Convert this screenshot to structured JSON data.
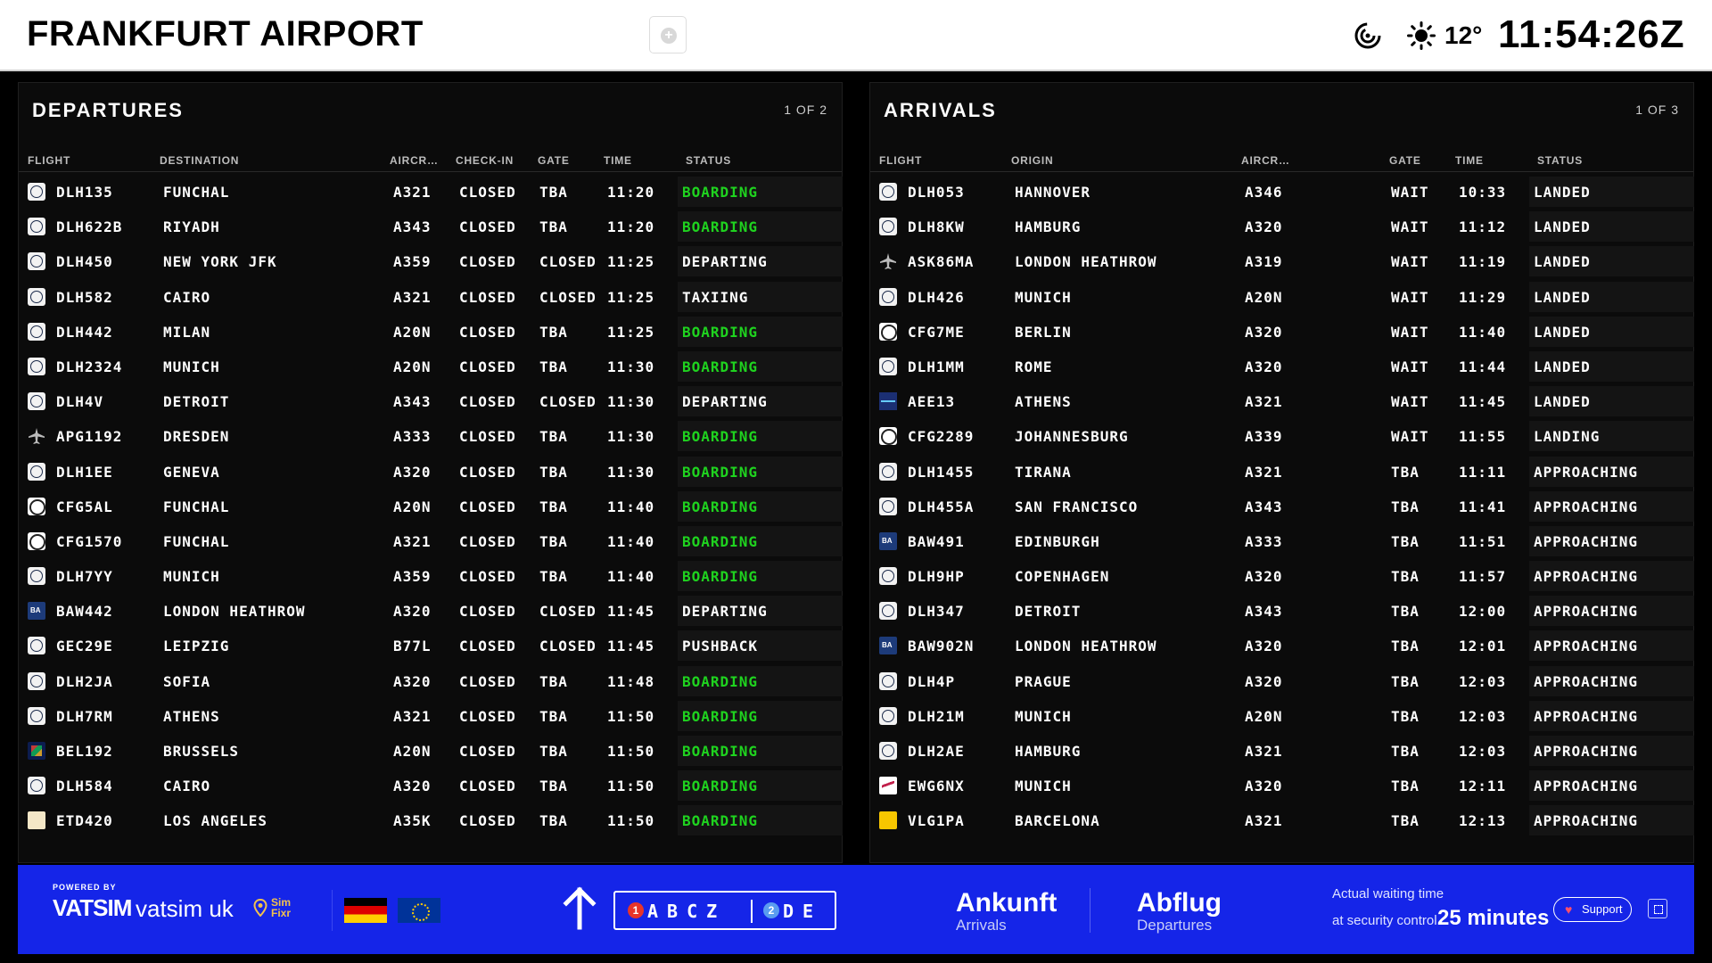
{
  "header": {
    "title": "FRANKFURT AIRPORT",
    "temperature": "12°",
    "clock": "11:54:26Z",
    "icons": {
      "add": "plus-circle-icon",
      "radar": "radar-icon",
      "weather": "sun-icon"
    }
  },
  "departures": {
    "title": "DEPARTURES",
    "page": "1 OF 2",
    "columns": {
      "flight": "FLIGHT",
      "destination": "DESTINATION",
      "aircraft": "AIRCR…",
      "checkin": "CHECK-IN",
      "gate": "GATE",
      "time": "TIME",
      "status": "STATUS"
    },
    "rows": [
      {
        "logo": "lh",
        "flight": "DLH135",
        "place": "FUNCHAL",
        "aircraft": "A321",
        "checkin": "CLOSED",
        "gate": "TBA",
        "time": "11:20",
        "status": "BOARDING",
        "highlight": true
      },
      {
        "logo": "lh",
        "flight": "DLH622B",
        "place": "RIYADH",
        "aircraft": "A343",
        "checkin": "CLOSED",
        "gate": "TBA",
        "time": "11:20",
        "status": "BOARDING",
        "highlight": true
      },
      {
        "logo": "lh",
        "flight": "DLH450",
        "place": "NEW YORK JFK",
        "aircraft": "A359",
        "checkin": "CLOSED",
        "gate": "CLOSED",
        "time": "11:25",
        "status": "DEPARTING",
        "highlight": false
      },
      {
        "logo": "lh",
        "flight": "DLH582",
        "place": "CAIRO",
        "aircraft": "A321",
        "checkin": "CLOSED",
        "gate": "CLOSED",
        "time": "11:25",
        "status": "TAXIING",
        "highlight": false
      },
      {
        "logo": "lh",
        "flight": "DLH442",
        "place": "MILAN",
        "aircraft": "A20N",
        "checkin": "CLOSED",
        "gate": "TBA",
        "time": "11:25",
        "status": "BOARDING",
        "highlight": true
      },
      {
        "logo": "lh",
        "flight": "DLH2324",
        "place": "MUNICH",
        "aircraft": "A20N",
        "checkin": "CLOSED",
        "gate": "TBA",
        "time": "11:30",
        "status": "BOARDING",
        "highlight": true
      },
      {
        "logo": "lh",
        "flight": "DLH4V",
        "place": "DETROIT",
        "aircraft": "A343",
        "checkin": "CLOSED",
        "gate": "CLOSED",
        "time": "11:30",
        "status": "DEPARTING",
        "highlight": false
      },
      {
        "logo": "plane",
        "flight": "APG1192",
        "place": "DRESDEN",
        "aircraft": "A333",
        "checkin": "CLOSED",
        "gate": "TBA",
        "time": "11:30",
        "status": "BOARDING",
        "highlight": true
      },
      {
        "logo": "lh",
        "flight": "DLH1EE",
        "place": "GENEVA",
        "aircraft": "A320",
        "checkin": "CLOSED",
        "gate": "TBA",
        "time": "11:30",
        "status": "BOARDING",
        "highlight": true
      },
      {
        "logo": "cf",
        "flight": "CFG5AL",
        "place": "FUNCHAL",
        "aircraft": "A20N",
        "checkin": "CLOSED",
        "gate": "TBA",
        "time": "11:40",
        "status": "BOARDING",
        "highlight": true
      },
      {
        "logo": "cf",
        "flight": "CFG1570",
        "place": "FUNCHAL",
        "aircraft": "A321",
        "checkin": "CLOSED",
        "gate": "TBA",
        "time": "11:40",
        "status": "BOARDING",
        "highlight": true
      },
      {
        "logo": "lh",
        "flight": "DLH7YY",
        "place": "MUNICH",
        "aircraft": "A359",
        "checkin": "CLOSED",
        "gate": "TBA",
        "time": "11:40",
        "status": "BOARDING",
        "highlight": true
      },
      {
        "logo": "ba",
        "flight": "BAW442",
        "place": "LONDON HEATHROW",
        "aircraft": "A320",
        "checkin": "CLOSED",
        "gate": "CLOSED",
        "time": "11:45",
        "status": "DEPARTING",
        "highlight": false
      },
      {
        "logo": "lh",
        "flight": "GEC29E",
        "place": "LEIPZIG",
        "aircraft": "B77L",
        "checkin": "CLOSED",
        "gate": "CLOSED",
        "time": "11:45",
        "status": "PUSHBACK",
        "highlight": false
      },
      {
        "logo": "lh",
        "flight": "DLH2JA",
        "place": "SOFIA",
        "aircraft": "A320",
        "checkin": "CLOSED",
        "gate": "TBA",
        "time": "11:48",
        "status": "BOARDING",
        "highlight": true
      },
      {
        "logo": "lh",
        "flight": "DLH7RM",
        "place": "ATHENS",
        "aircraft": "A321",
        "checkin": "CLOSED",
        "gate": "TBA",
        "time": "11:50",
        "status": "BOARDING",
        "highlight": true
      },
      {
        "logo": "bel",
        "flight": "BEL192",
        "place": "BRUSSELS",
        "aircraft": "A20N",
        "checkin": "CLOSED",
        "gate": "TBA",
        "time": "11:50",
        "status": "BOARDING",
        "highlight": true
      },
      {
        "logo": "lh",
        "flight": "DLH584",
        "place": "CAIRO",
        "aircraft": "A320",
        "checkin": "CLOSED",
        "gate": "TBA",
        "time": "11:50",
        "status": "BOARDING",
        "highlight": true
      },
      {
        "logo": "etd",
        "flight": "ETD420",
        "place": "LOS ANGELES",
        "aircraft": "A35K",
        "checkin": "CLOSED",
        "gate": "TBA",
        "time": "11:50",
        "status": "BOARDING",
        "highlight": true
      }
    ]
  },
  "arrivals": {
    "title": "ARRIVALS",
    "page": "1 OF 3",
    "columns": {
      "flight": "FLIGHT",
      "origin": "ORIGIN",
      "aircraft": "AIRCR…",
      "gate": "GATE",
      "time": "TIME",
      "status": "STATUS"
    },
    "rows": [
      {
        "logo": "lh",
        "flight": "DLH053",
        "place": "HANNOVER",
        "aircraft": "A346",
        "gate": "WAIT",
        "time": "10:33",
        "status": "LANDED"
      },
      {
        "logo": "lh",
        "flight": "DLH8KW",
        "place": "HAMBURG",
        "aircraft": "A320",
        "gate": "WAIT",
        "time": "11:12",
        "status": "LANDED"
      },
      {
        "logo": "plane",
        "flight": "ASK86MA",
        "place": "LONDON HEATHROW",
        "aircraft": "A319",
        "gate": "WAIT",
        "time": "11:19",
        "status": "LANDED"
      },
      {
        "logo": "lh",
        "flight": "DLH426",
        "place": "MUNICH",
        "aircraft": "A20N",
        "gate": "WAIT",
        "time": "11:29",
        "status": "LANDED"
      },
      {
        "logo": "cf",
        "flight": "CFG7ME",
        "place": "BERLIN",
        "aircraft": "A320",
        "gate": "WAIT",
        "time": "11:40",
        "status": "LANDED"
      },
      {
        "logo": "lh",
        "flight": "DLH1MM",
        "place": "ROME",
        "aircraft": "A320",
        "gate": "WAIT",
        "time": "11:44",
        "status": "LANDED"
      },
      {
        "logo": "aee",
        "flight": "AEE13",
        "place": "ATHENS",
        "aircraft": "A321",
        "gate": "WAIT",
        "time": "11:45",
        "status": "LANDED"
      },
      {
        "logo": "cf",
        "flight": "CFG2289",
        "place": "JOHANNESBURG",
        "aircraft": "A339",
        "gate": "WAIT",
        "time": "11:55",
        "status": "LANDING"
      },
      {
        "logo": "lh",
        "flight": "DLH1455",
        "place": "TIRANA",
        "aircraft": "A321",
        "gate": "TBA",
        "time": "11:11",
        "status": "APPROACHING"
      },
      {
        "logo": "lh",
        "flight": "DLH455A",
        "place": "SAN FRANCISCO",
        "aircraft": "A343",
        "gate": "TBA",
        "time": "11:41",
        "status": "APPROACHING"
      },
      {
        "logo": "ba",
        "flight": "BAW491",
        "place": "EDINBURGH",
        "aircraft": "A333",
        "gate": "TBA",
        "time": "11:51",
        "status": "APPROACHING"
      },
      {
        "logo": "lh",
        "flight": "DLH9HP",
        "place": "COPENHAGEN",
        "aircraft": "A320",
        "gate": "TBA",
        "time": "11:57",
        "status": "APPROACHING"
      },
      {
        "logo": "lh",
        "flight": "DLH347",
        "place": "DETROIT",
        "aircraft": "A343",
        "gate": "TBA",
        "time": "12:00",
        "status": "APPROACHING"
      },
      {
        "logo": "ba",
        "flight": "BAW902N",
        "place": "LONDON HEATHROW",
        "aircraft": "A320",
        "gate": "TBA",
        "time": "12:01",
        "status": "APPROACHING"
      },
      {
        "logo": "lh",
        "flight": "DLH4P",
        "place": "PRAGUE",
        "aircraft": "A320",
        "gate": "TBA",
        "time": "12:03",
        "status": "APPROACHING"
      },
      {
        "logo": "lh",
        "flight": "DLH21M",
        "place": "MUNICH",
        "aircraft": "A20N",
        "gate": "TBA",
        "time": "12:03",
        "status": "APPROACHING"
      },
      {
        "logo": "lh",
        "flight": "DLH2AE",
        "place": "HAMBURG",
        "aircraft": "A321",
        "gate": "TBA",
        "time": "12:03",
        "status": "APPROACHING"
      },
      {
        "logo": "ew",
        "flight": "EWG6NX",
        "place": "MUNICH",
        "aircraft": "A320",
        "gate": "TBA",
        "time": "12:11",
        "status": "APPROACHING"
      },
      {
        "logo": "vlg",
        "flight": "VLG1PA",
        "place": "BARCELONA",
        "aircraft": "A321",
        "gate": "TBA",
        "time": "12:13",
        "status": "APPROACHING"
      }
    ]
  },
  "footer": {
    "powered_by": "POWERED BY",
    "vatsim": "VATSIM",
    "vatsim_uk": "vatsim uk",
    "simfixr_line1": "Sim",
    "simfixr_line2": "Fixr",
    "gate_group1_num": "1",
    "gate_group1_letters": "ABCZ",
    "gate_group2_num": "2",
    "gate_group2_letters": "DE",
    "arrivals_de": "Ankunft",
    "arrivals_en": "Arrivals",
    "departures_de": "Abflug",
    "departures_en": "Departures",
    "waiting_line1": "Actual waiting time",
    "waiting_line2": "at security control",
    "waiting_value": "25 minutes",
    "support_label": "Support",
    "colors": {
      "background": "#1525e8",
      "boarding": "#1fd31f"
    }
  }
}
